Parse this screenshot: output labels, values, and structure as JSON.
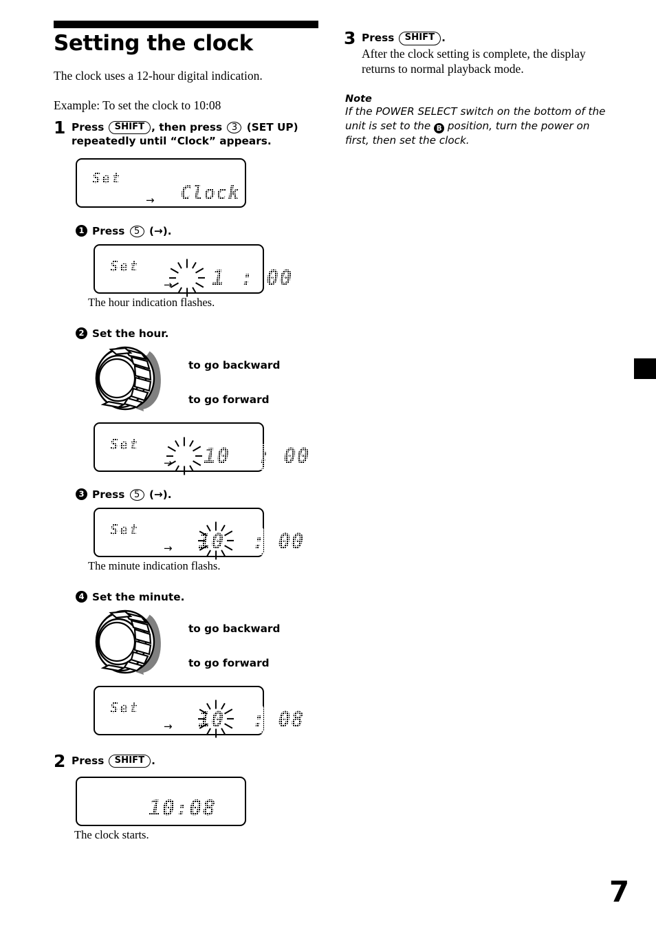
{
  "page": {
    "number": "7",
    "tab_marker": "black-tab-marker"
  },
  "heading": {
    "title": "Setting the clock",
    "intro": "The clock uses a 12-hour digital indication.",
    "example": "Example: To set the clock to 10:08"
  },
  "steps": [
    {
      "num": "1",
      "line1_pre": "Press",
      "key1": "SHIFT",
      "line1_mid": ", then press",
      "key2": "3",
      "line1_post": "(SET UP)",
      "line2": "repeatedly until “Clock” appears."
    },
    {
      "num": "2",
      "line1_pre": "Press",
      "key1": "SHIFT",
      "line1_post": "."
    },
    {
      "num": "3",
      "line1_pre": "Press",
      "key1": "SHIFT",
      "line1_post": ".",
      "body": "After the clock setting is complete, the display returns to normal playback mode."
    }
  ],
  "substeps": [
    {
      "num": "1",
      "label_pre": "Press",
      "key": "5",
      "label_post": "(→)."
    },
    {
      "num": "2",
      "label": "Set the hour."
    },
    {
      "num": "3",
      "label_pre": "Press",
      "key": "5",
      "label_post": "(→)."
    },
    {
      "num": "4",
      "label": "Set the minute."
    }
  ],
  "displays": {
    "clock_word": {
      "set": "Set",
      "value": "Clock",
      "arrow": "→"
    },
    "hour_flash": {
      "set": "Set",
      "hour": "1",
      "sep": ":",
      "minute": "00",
      "arrow": "→",
      "flashing": "hour"
    },
    "hour_set": {
      "set": "Set",
      "hour": "10",
      "sep": ":",
      "minute": "00",
      "arrow": "→",
      "flashing": "hour"
    },
    "minute_flash": {
      "set": "Set",
      "hour": "10",
      "sep": ":",
      "minute": "00",
      "arrow": "→",
      "flashing": "minute"
    },
    "minute_set": {
      "set": "Set",
      "hour": "10",
      "sep": ":",
      "minute": "08",
      "arrow": "→",
      "flashing": "minute"
    },
    "final": {
      "value": "10:08"
    }
  },
  "captions": {
    "hour_flashes": "The hour indication flashes.",
    "minute_flashes": "The minute indication flashs.",
    "clock_starts": "The clock starts."
  },
  "dial": {
    "backward": "to go backward",
    "forward": "to go forward",
    "icon": "rotary-dial-icon",
    "arrow_color": "#808080"
  },
  "note": {
    "heading": "Note",
    "text_before": "If the POWER SELECT switch on the bottom of the unit is set to the",
    "badge": "B",
    "text_after": "position, turn the power on first, then set the clock."
  }
}
